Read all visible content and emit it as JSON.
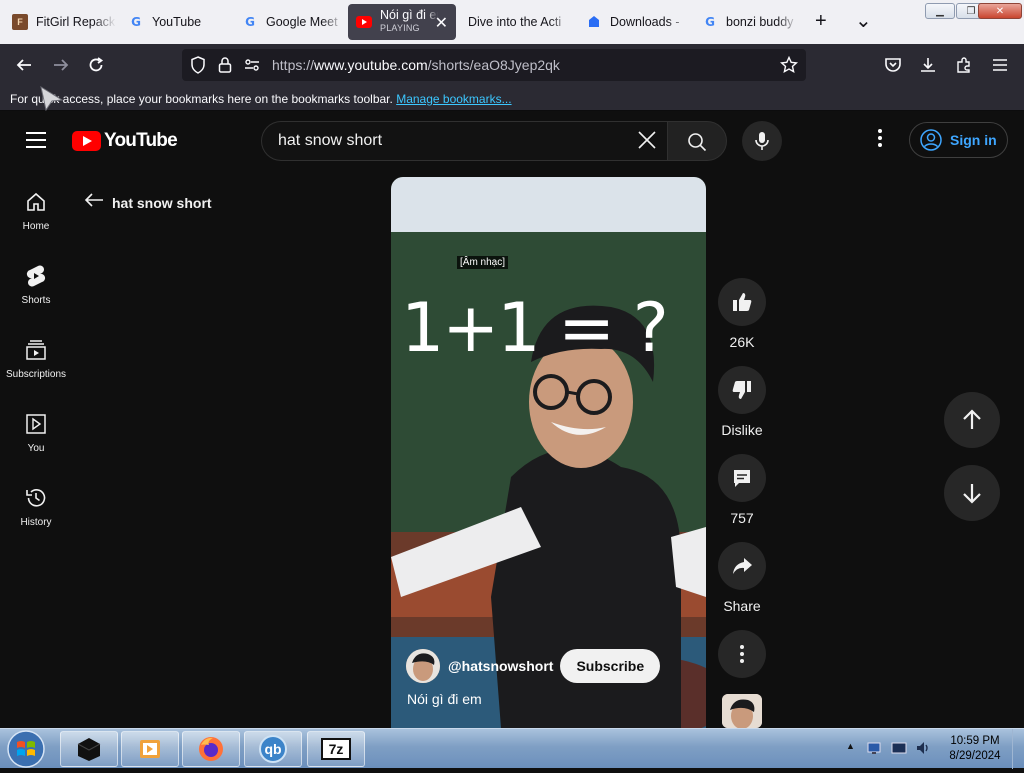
{
  "browser": {
    "tabs": [
      {
        "title": "FitGirl Repack",
        "icon": "fitgirl-favicon"
      },
      {
        "title": "YouTube",
        "icon": "google-favicon"
      },
      {
        "title": "Google Meet",
        "icon": "google-favicon"
      },
      {
        "title": "Nói gì đi em",
        "subtitle": "PLAYING",
        "icon": "youtube-favicon",
        "active": true
      },
      {
        "title": "Dive into the Acti",
        "icon": "blank-favicon"
      },
      {
        "title": "Downloads -",
        "icon": "puzzle-favicon"
      },
      {
        "title": "bonzi buddy",
        "icon": "google-favicon"
      }
    ],
    "new_tab": "+",
    "tab_list": "⌄",
    "url_prefix": "https://",
    "url_host": "www.youtube.com",
    "url_path": "/shorts/eaO8Jyep2qk",
    "bookmarks_text": "For quick access, place your bookmarks here on the bookmarks toolbar.",
    "bookmarks_link": "Manage bookmarks..."
  },
  "youtube": {
    "logo_text": "YouTube",
    "search_value": "hat snow short",
    "signin_label": "Sign in",
    "guide": [
      {
        "label": "Home",
        "icon": "home-icon"
      },
      {
        "label": "Shorts",
        "icon": "shorts-icon"
      },
      {
        "label": "Subscriptions",
        "icon": "subscriptions-icon"
      },
      {
        "label": "You",
        "icon": "you-icon"
      },
      {
        "label": "History",
        "icon": "history-icon"
      }
    ],
    "back_label": "hat snow short",
    "video": {
      "caption_tag": "[Âm nhạc]",
      "board_text": "1+1 = ?",
      "channel": "@hatsnowshort",
      "subscribe_label": "Subscribe",
      "title": "Nói gì đi em"
    },
    "actions": {
      "likes": "26K",
      "dislike_label": "Dislike",
      "comments": "757",
      "share_label": "Share"
    }
  },
  "taskbar": {
    "time": "10:59 PM",
    "date": "8/29/2024",
    "apps": [
      "terminal-app",
      "media-player-app",
      "firefox-app",
      "qbittorrent-app",
      "7zip-app"
    ],
    "qb_label": "qb",
    "zip_label": "7z"
  }
}
